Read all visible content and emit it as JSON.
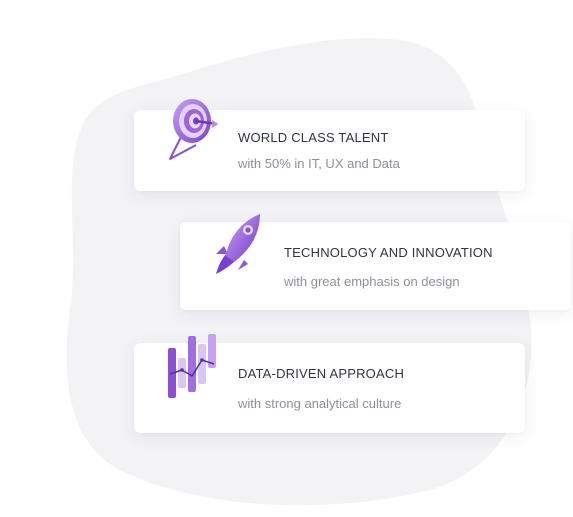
{
  "features": [
    {
      "title": "WORLD CLASS TALENT",
      "subtitle": "with 50% in IT, UX and Data",
      "icon": "target-icon"
    },
    {
      "title": "TECHNOLOGY AND INNOVATION",
      "subtitle": "with great emphasis on design",
      "icon": "rocket-icon"
    },
    {
      "title": "DATA-DRIVEN APPROACH",
      "subtitle": "with strong analytical culture",
      "icon": "chart-icon"
    }
  ],
  "colors": {
    "accent": "#8b4fd6",
    "accent_light": "#d9c6f3",
    "blob": "#f3f3f6",
    "title": "#2f3346",
    "subtitle": "#8d8f9b"
  }
}
